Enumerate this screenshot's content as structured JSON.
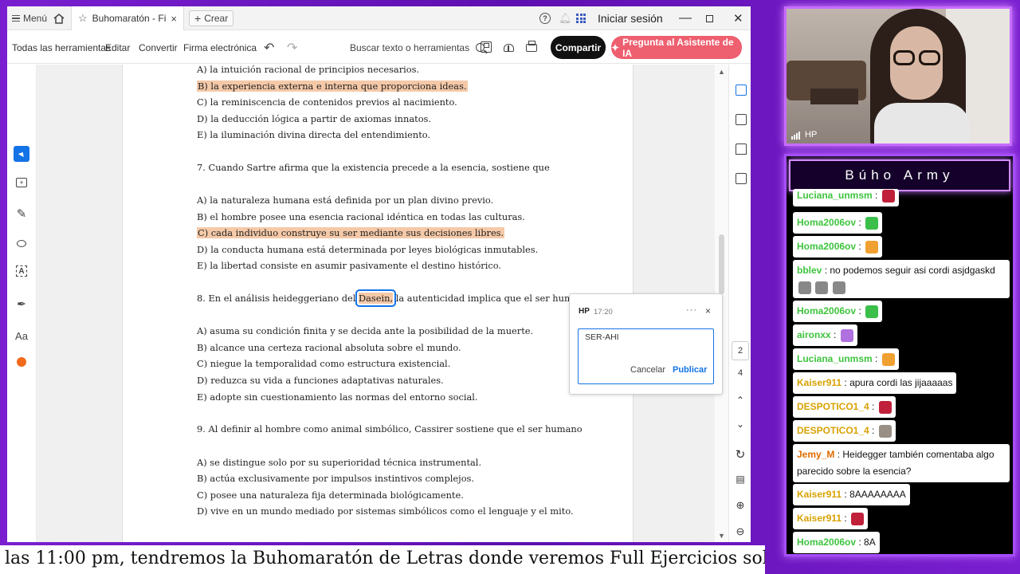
{
  "acrobat": {
    "titlebar": {
      "menu_label": "Menú",
      "tab_title": "Buhomaratón - Filos...",
      "tab_close": "×",
      "create_label": "Crear",
      "signin_label": "Iniciar sesión",
      "help_glyph": "?"
    },
    "toolbar": {
      "all_tools": "Todas las herramientas",
      "edit": "Editar",
      "convert": "Convertir",
      "esign": "Firma electrónica",
      "search_placeholder": "Buscar texto o herramientas",
      "share": "Compartir",
      "ai_assistant": "Pregunta al Asistente de IA"
    },
    "left_rail": {
      "font_tool": "Aa"
    },
    "document": {
      "lines": [
        "A) la intuición racional de principios necesarios.",
        "B) la experiencia externa e interna que proporciona ideas.",
        "C) la reminiscencia de contenidos previos al nacimiento.",
        "D) la deducción lógica a partir de axiomas innatos.",
        "E) la iluminación divina directa del entendimiento.",
        "7. Cuando Sartre afirma que la existencia precede a la esencia, sostiene que",
        "A) la naturaleza humana está definida por un plan divino previo.",
        "B) el hombre posee una esencia racional idéntica en todas las culturas.",
        "C) cada individuo construye su ser mediante sus decisiones libres.",
        "D) la conducta humana está determinada por leyes biológicas inmutables.",
        "E) la libertad consiste en asumir pasivamente el destino histórico.",
        "8. En el análisis heideggeriano del",
        "Dasein,",
        "la autenticidad implica que el ser humano",
        "A) asuma su condición finita y se decida ante la posibilidad de la muerte.",
        "B) alcance una certeza racional absoluta sobre el mundo.",
        "C) niegue la temporalidad como estructura existencial.",
        "D) reduzca su vida a funciones adaptativas naturales.",
        "E) adopte sin cuestionamiento las normas del entorno social.",
        "9. Al definir al hombre como animal simbólico, Cassirer sostiene que el ser humano",
        "A) se distingue solo por su superioridad técnica instrumental.",
        "B) actúa exclusivamente por impulsos instintivos complejos.",
        "C) posee una naturaleza fija determinada biológicamente.",
        "D) vive en un mundo mediado por sistemas simbólicos como el lenguaje y el mito."
      ]
    },
    "comment": {
      "author": "HP",
      "time": "17:20",
      "more": "···",
      "close": "×",
      "text": "SER-AHI",
      "cancel": "Cancelar",
      "publish": "Publicar"
    },
    "nav": {
      "current_page": "2",
      "total_pages": "4"
    },
    "colors": {
      "accent": "#1473e6",
      "highlight": "#f5c9a8",
      "ai_button": "#ee5f6f"
    }
  },
  "ticker": {
    "text": "las 11:00 pm, tendremos la Buhomaratón de Letras donde veremos Full Ejercicios solo de los Temas"
  },
  "webcam": {
    "label": "HP"
  },
  "chat": {
    "title": "Búho Army",
    "messages": [
      {
        "user": "Luciana_unmsm",
        "text": ":"
      },
      {
        "user": "Homa2006ov",
        "text": ":"
      },
      {
        "user": "Homa2006ov",
        "text": ":"
      },
      {
        "user": "bblev",
        "text": ": no podemos seguir asi cordi asjdgaskd"
      },
      {
        "user": "Homa2006ov",
        "text": ":"
      },
      {
        "user": "aironxx",
        "text": ":"
      },
      {
        "user": "Luciana_unmsm",
        "text": ":"
      },
      {
        "user": "Kaiser911",
        "text": ": apura cordi las jijaaaaas"
      },
      {
        "user": "DESPOTICO1_4",
        "text": ":"
      },
      {
        "user": "DESPOTICO1_4",
        "text": ":"
      },
      {
        "user": "Jemy_M",
        "text": ": Heidegger también comentaba algo parecido sobre la esencia?"
      },
      {
        "user": "Kaiser911",
        "text": ": 8AAAAAAAA"
      },
      {
        "user": "Kaiser911",
        "text": ":"
      },
      {
        "user": "Homa2006ov",
        "text": ": 8A"
      }
    ]
  }
}
